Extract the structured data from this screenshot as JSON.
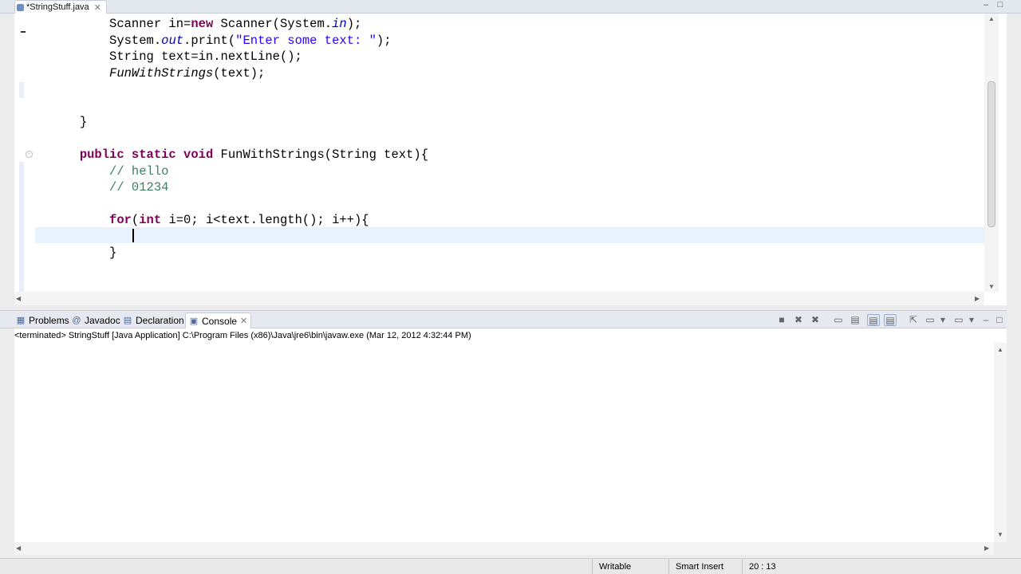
{
  "editor": {
    "tab_label": "*StringStuff.java",
    "code_lines": [
      [
        "    ",
        {
          "t": "Scanner in=",
          "c": ""
        },
        {
          "t": "new",
          "c": "kw"
        },
        {
          "t": " Scanner(System.",
          "c": ""
        },
        {
          "t": "in",
          "c": "fld"
        },
        {
          "t": ");",
          "c": ""
        }
      ],
      [
        "    ",
        {
          "t": "System.",
          "c": ""
        },
        {
          "t": "out",
          "c": "fld"
        },
        {
          "t": ".print(",
          "c": ""
        },
        {
          "t": "\"Enter some text: \"",
          "c": "str"
        },
        {
          "t": ");",
          "c": ""
        }
      ],
      [
        "    ",
        {
          "t": "String text=in.nextLine();",
          "c": ""
        }
      ],
      [
        "    ",
        {
          "t": "FunWithStrings",
          "c": "ital"
        },
        {
          "t": "(text);",
          "c": ""
        }
      ],
      [
        ""
      ],
      [
        ""
      ],
      [
        "",
        {
          "t": "}",
          "c": ""
        }
      ],
      [
        ""
      ],
      [
        "",
        {
          "t": "public static void",
          "c": "kw"
        },
        {
          "t": " FunWithStrings(String text){",
          "c": ""
        }
      ],
      [
        "    ",
        {
          "t": "// hello",
          "c": "cmt"
        }
      ],
      [
        "    ",
        {
          "t": "// 01234",
          "c": "cmt"
        }
      ],
      [
        ""
      ],
      [
        "    ",
        {
          "t": "for",
          "c": "kw"
        },
        {
          "t": "(",
          "c": ""
        },
        {
          "t": "int",
          "c": "kw"
        },
        {
          "t": " i=0; i<text.length(); i++){",
          "c": ""
        }
      ],
      [
        ""
      ],
      [
        "    ",
        {
          "t": "}",
          "c": ""
        }
      ]
    ]
  },
  "panel": {
    "tabs": [
      {
        "label": "Problems",
        "icon": "problems-icon"
      },
      {
        "label": "Javadoc",
        "icon": "javadoc-icon"
      },
      {
        "label": "Declaration",
        "icon": "declaration-icon"
      },
      {
        "label": "Console",
        "icon": "console-icon"
      }
    ],
    "console_header": "<terminated> StringStuff [Java Application] C:\\Program Files (x86)\\Java\\jre6\\bin\\javaw.exe (Mar 12, 2012 4:32:44 PM)"
  },
  "status": {
    "writable": "Writable",
    "insert_mode": "Smart Insert",
    "position": "20 : 13"
  },
  "colors": {
    "keyword": "#7f0055",
    "string": "#2a00ff",
    "comment": "#3f7f5f",
    "current_line": "#e8f2fe"
  }
}
